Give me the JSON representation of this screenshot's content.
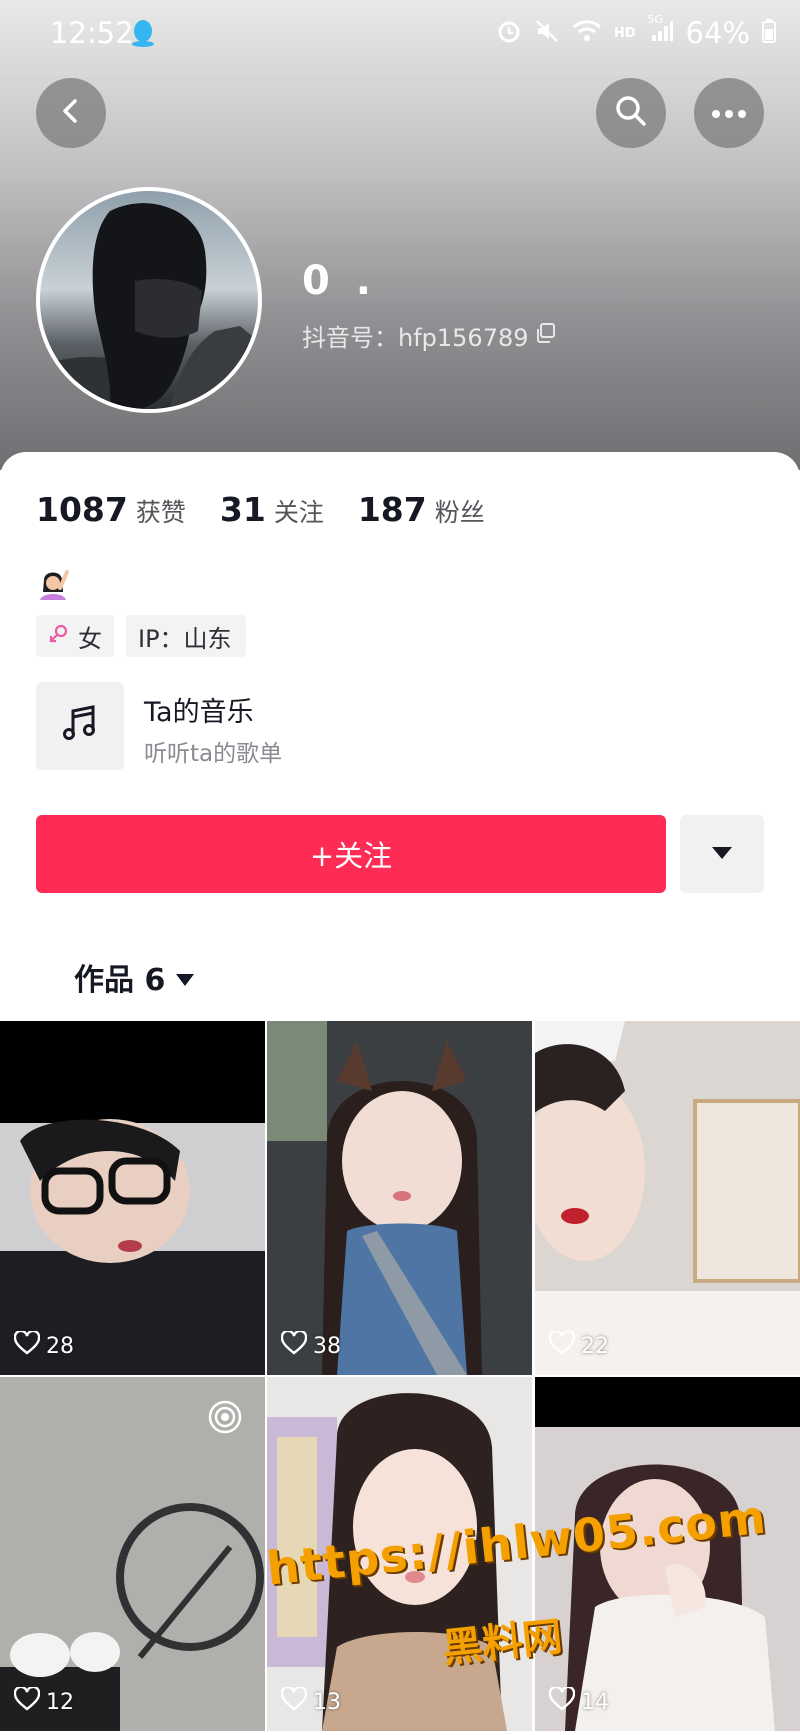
{
  "status_bar": {
    "time": "12:52",
    "battery": "64%",
    "network": "5G",
    "hd": "HD"
  },
  "header": {
    "nickname": "0 .",
    "douyin_id": "抖音号：hfp156789",
    "icons": [
      "back-icon",
      "search-icon",
      "more-icon"
    ]
  },
  "stats": [
    {
      "value": "1087",
      "label": "获赞"
    },
    {
      "value": "31",
      "label": "关注"
    },
    {
      "value": "187",
      "label": "粉丝"
    }
  ],
  "tags": {
    "gender": "女",
    "ip": "IP：山东"
  },
  "music": {
    "title": "Ta的音乐",
    "subtitle": "听听ta的歌单"
  },
  "actions": {
    "follow": "+关注"
  },
  "works_tab": {
    "label": "作品 6"
  },
  "videos": [
    {
      "likes": "28"
    },
    {
      "likes": "38"
    },
    {
      "likes": "22"
    },
    {
      "likes": "12"
    },
    {
      "likes": "13"
    },
    {
      "likes": "14"
    }
  ],
  "watermark": {
    "url": "https://ihlw05.com",
    "name": "黑料网"
  },
  "colors": {
    "accent": "#fe2c55",
    "watermark": "#f4a000"
  }
}
